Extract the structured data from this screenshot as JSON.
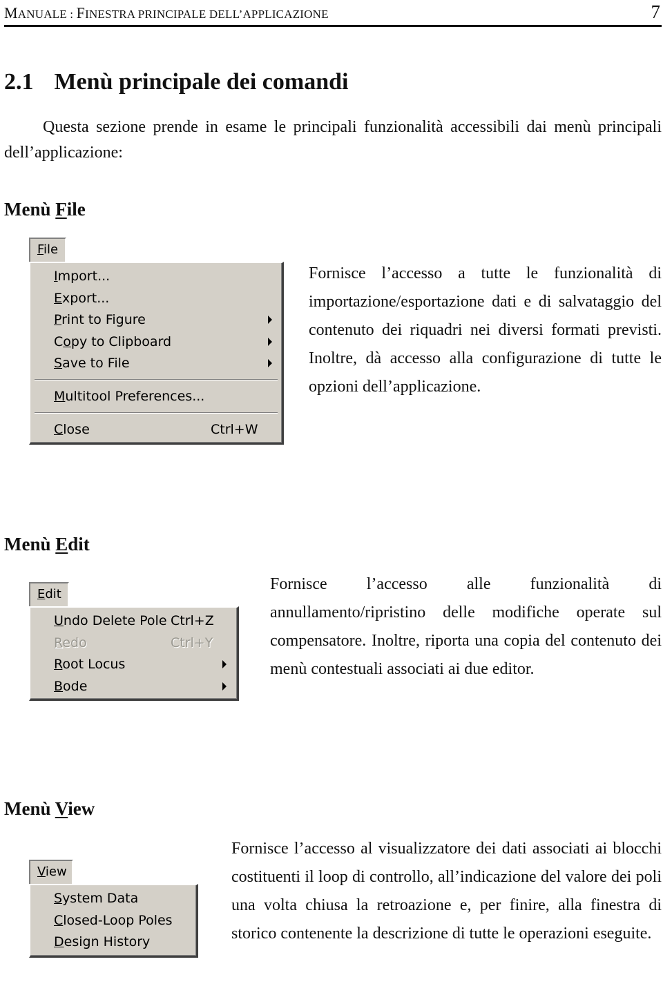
{
  "running_header": {
    "title_parts": [
      {
        "big": "M",
        "small": "ANUALE : "
      },
      {
        "big": "F",
        "small": "INESTRA PRINCIPALE DELL’APPLICAZIONE"
      }
    ],
    "page_number": "7"
  },
  "section": {
    "number": "2.1",
    "title": "Menù principale dei comandi",
    "intro": "Questa sezione prende in esame le principali funzionalità accessibili dai menù principali dell’applicazione:"
  },
  "menus": {
    "file": {
      "heading_prefix": "Menù ",
      "heading_accel": "F",
      "heading_rest": "ile",
      "bar_label_accel": "F",
      "bar_label_rest": "ile",
      "items": [
        {
          "accel": "I",
          "rest": "mport...",
          "shortcut": "",
          "submenu": false,
          "disabled": false
        },
        {
          "accel": "E",
          "rest": "xport...",
          "shortcut": "",
          "submenu": false,
          "disabled": false
        },
        {
          "accel": "P",
          "rest": "rint to Figure",
          "shortcut": "",
          "submenu": true,
          "disabled": false
        },
        {
          "pre": "C",
          "accel": "o",
          "rest": "py to Clipboard",
          "shortcut": "",
          "submenu": true,
          "disabled": false
        },
        {
          "accel": "S",
          "rest": "ave to File",
          "shortcut": "",
          "submenu": true,
          "disabled": false
        },
        {
          "accel": "M",
          "rest": "ultitool Preferences...",
          "shortcut": "",
          "submenu": false,
          "disabled": false
        },
        {
          "accel": "C",
          "rest": "lose",
          "shortcut": "Ctrl+W",
          "submenu": false,
          "disabled": false
        }
      ],
      "description": "Fornisce l’accesso a tutte le funzionalità di importazione/esportazione dati e di salvataggio del contenuto dei riquadri nei diversi formati previsti. Inoltre, dà accesso alla configurazione di tutte le opzioni dell’applicazione."
    },
    "edit": {
      "heading_prefix": "Menù ",
      "heading_accel": "E",
      "heading_rest": "dit",
      "bar_label_accel": "E",
      "bar_label_rest": "dit",
      "items": [
        {
          "accel": "U",
          "rest": "ndo Delete Pole",
          "shortcut": "Ctrl+Z",
          "submenu": false,
          "disabled": false
        },
        {
          "accel": "R",
          "rest": "edo",
          "shortcut": "Ctrl+Y",
          "submenu": false,
          "disabled": true
        },
        {
          "accel": "R",
          "rest": "oot Locus",
          "shortcut": "",
          "submenu": true,
          "disabled": false
        },
        {
          "accel": "B",
          "rest": "ode",
          "shortcut": "",
          "submenu": true,
          "disabled": false
        }
      ],
      "description": "Fornisce l’accesso alle funzionalità di annullamento/ripristino delle modifiche operate sul compensatore. Inoltre, riporta una copia del contenuto dei menù contestuali associati ai due editor."
    },
    "view": {
      "heading_prefix": "Menù ",
      "heading_accel": "V",
      "heading_rest": "iew",
      "bar_label_accel": "V",
      "bar_label_rest": "iew",
      "items": [
        {
          "accel": "S",
          "rest": "ystem Data",
          "shortcut": "",
          "submenu": false,
          "disabled": false
        },
        {
          "accel": "C",
          "rest": "losed-Loop Poles",
          "shortcut": "",
          "submenu": false,
          "disabled": false
        },
        {
          "accel": "D",
          "rest": "esign History",
          "shortcut": "",
          "submenu": false,
          "disabled": false
        }
      ],
      "description": "Fornisce l’accesso al visualizzatore dei dati associati ai blocchi costituenti il loop di controllo, all’indicazione del valore dei poli una volta chiusa la retroazione e, per finire, alla finestra di storico contenente la descrizione di tutte le operazioni eseguite."
    }
  }
}
